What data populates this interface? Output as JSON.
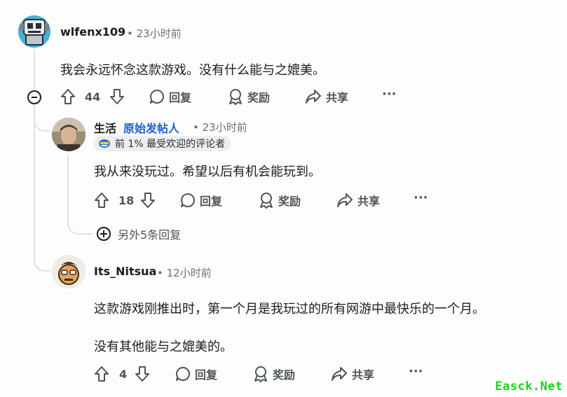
{
  "comments": [
    {
      "username": "wlfenx109",
      "time": "• 23小时前",
      "body": "我会永远怀念这款游戏。没有什么能与之媲美。",
      "votes": "44",
      "reply": "回复",
      "award": "奖励",
      "share": "共享",
      "more": "···"
    },
    {
      "flair": "生活",
      "op_label": "原始发帖人",
      "time": "• 23小时前",
      "badge": "前 1% 最受欢迎的评论者",
      "body": "我从来没玩过。希望以后有机会能玩到。",
      "votes": "18",
      "reply": "回复",
      "award": "奖励",
      "share": "共享",
      "more": "···",
      "more_replies": "另外5条回复"
    },
    {
      "username": "Its_Nitsua",
      "time": "• 12小时前",
      "body_line1": "这款游戏刚推出时，第一个月是我玩过的所有网游中最快乐的一个月。",
      "body_line2": "没有其他能与之媲美的。",
      "votes": "4",
      "reply": "回复",
      "award": "奖励",
      "share": "共享",
      "more": "···"
    }
  ],
  "watermark": "Easck.Net",
  "icons": [
    "robot-avatar",
    "upvote-icon",
    "downvote-icon",
    "comment-bubble-icon",
    "award-icon",
    "share-icon",
    "collapse-icon",
    "expand-icon",
    "trophy-badge-icon"
  ],
  "colors": {
    "op_blue": "#1a5fd6",
    "meta_gray": "#6b6f73",
    "thread_line": "#dfe1e3",
    "watermark_green": "#19d419"
  }
}
